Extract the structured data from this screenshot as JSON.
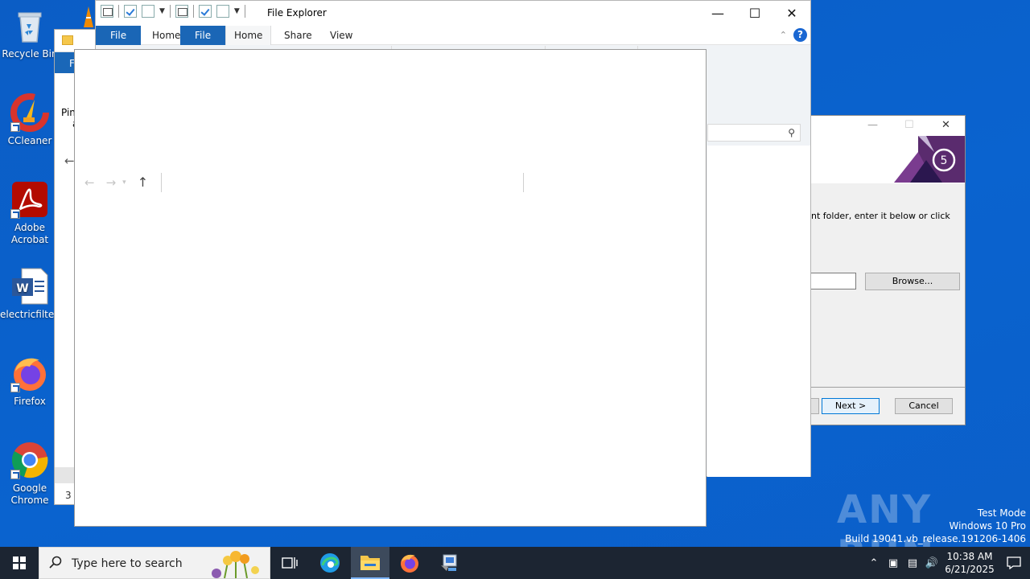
{
  "desktop": {
    "icons": [
      {
        "label": "Recycle Bin"
      },
      {
        "label": "CCleaner"
      },
      {
        "label": "Adobe Acrobat"
      },
      {
        "label": "electricfilte..."
      },
      {
        "label": "Firefox"
      },
      {
        "label": "Google Chrome"
      }
    ]
  },
  "back_window": {
    "tab_letter": "F",
    "pin_text": "Pin",
    "pin_text_2": "a",
    "status_text": "3 i"
  },
  "file_explorer": {
    "title": "File Explorer",
    "tabs": [
      "File",
      "Home",
      "File",
      "Home",
      "Share",
      "View"
    ],
    "help_glyph": "?"
  },
  "installer": {
    "instruction": "nt folder, enter it below or click",
    "browse_label": "Browse...",
    "next_label": "Next >",
    "cancel_label": "Cancel"
  },
  "watermark": {
    "brand": "ANY RUN",
    "line1": "Test Mode",
    "line2": "Windows 10 Pro",
    "line3": "Build 19041.vb_release.191206-1406"
  },
  "taskbar": {
    "search_placeholder": "Type here to search",
    "time": "10:38 AM",
    "date": "6/21/2025"
  }
}
